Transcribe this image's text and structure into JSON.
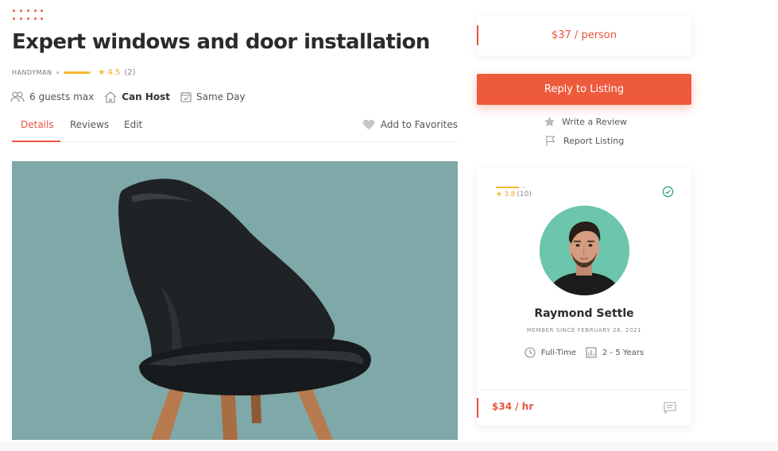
{
  "listing": {
    "title": "Expert windows and door installation",
    "category": "HANDYMAN",
    "rating": "4.5",
    "rating_fraction": 0.9,
    "review_count": "(2)"
  },
  "features": {
    "guests": "6 guests max",
    "host": "Can Host",
    "availability": "Same Day"
  },
  "tabs": [
    {
      "label": "Details",
      "active": true
    },
    {
      "label": "Reviews",
      "active": false
    },
    {
      "label": "Edit",
      "active": false
    }
  ],
  "favorites_label": "Add to Favorites",
  "sidebar": {
    "price": "$37 / person",
    "reply_label": "Reply to Listing",
    "write_review": "Write a Review",
    "report": "Report Listing"
  },
  "profile": {
    "rating": "3.8",
    "rating_fraction": 0.76,
    "review_count": "(10)",
    "name": "Raymond Settle",
    "member_since": "MEMBER SINCE FEBRUARY 28, 2021",
    "employment": "Full-Time",
    "experience": "2 - 5 Years",
    "rate": "$34 / hr"
  },
  "colors": {
    "accent": "#ee5a3c",
    "star": "#f5b82e",
    "photo_bg": "#7fa8a8",
    "avatar_bg": "#6cc5ad",
    "verified": "#2a9d6f"
  }
}
